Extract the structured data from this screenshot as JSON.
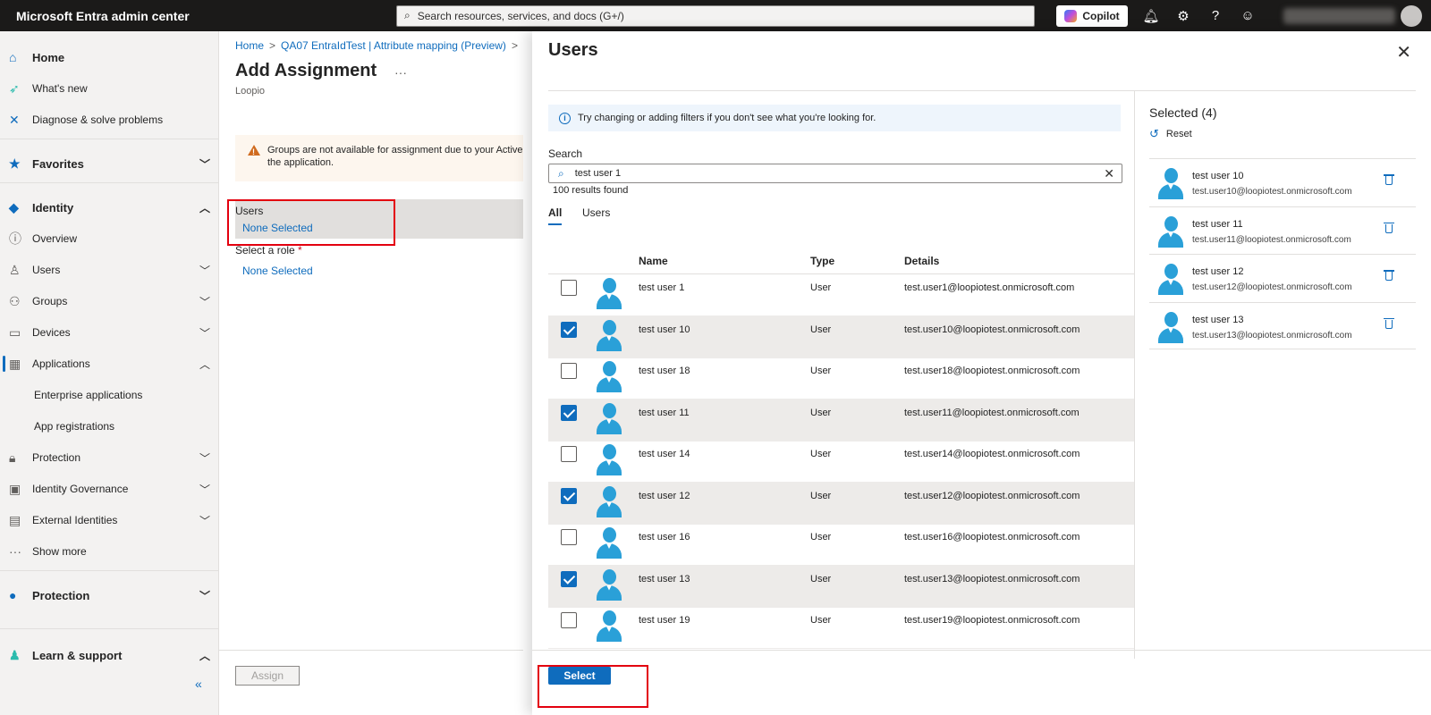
{
  "topbar": {
    "brand": "Microsoft Entra admin center",
    "search_placeholder": "Search resources, services, and docs (G+/)",
    "copilot_label": "Copilot",
    "icons": [
      "bell-icon",
      "gear-icon",
      "help-icon",
      "feedback-icon"
    ]
  },
  "nav": {
    "home": "Home",
    "whats_new": "What's new",
    "diagnose": "Diagnose & solve problems",
    "favorites": "Favorites",
    "identity": "Identity",
    "overview": "Overview",
    "users": "Users",
    "groups": "Groups",
    "devices": "Devices",
    "applications": "Applications",
    "enterprise_apps": "Enterprise applications",
    "app_registrations": "App registrations",
    "protection": "Protection",
    "identity_governance": "Identity Governance",
    "external_identities": "External Identities",
    "show_more": "Show more",
    "protection_section": "Protection",
    "learn_support": "Learn & support",
    "collapse": "«"
  },
  "main": {
    "breadcrumb": [
      "Home",
      "QA07 EntraIdTest | Attribute mapping (Preview)"
    ],
    "title": "Add Assignment",
    "subtitle": "Loopio",
    "warning_line1": "Groups are not available for assignment due to your Active Di",
    "warning_line2": "the application.",
    "users_label": "Users",
    "users_value": "None Selected",
    "role_label": "Select a role",
    "role_required": "*",
    "role_value": "None Selected",
    "assign_button": "Assign"
  },
  "panel": {
    "title": "Users",
    "info": "Try changing or adding filters if you don't see what you're looking for.",
    "search_label": "Search",
    "search_value": "test user 1",
    "results": "100 results found",
    "tabs": [
      "All",
      "Users"
    ],
    "columns": [
      "Name",
      "Type",
      "Details"
    ],
    "rows": [
      {
        "name": "test user 1",
        "type": "User",
        "details": "test.user1@loopiotest.onmicrosoft.com",
        "checked": false
      },
      {
        "name": "test user 10",
        "type": "User",
        "details": "test.user10@loopiotest.onmicrosoft.com",
        "checked": true
      },
      {
        "name": "test user 18",
        "type": "User",
        "details": "test.user18@loopiotest.onmicrosoft.com",
        "checked": false
      },
      {
        "name": "test user 11",
        "type": "User",
        "details": "test.user11@loopiotest.onmicrosoft.com",
        "checked": true
      },
      {
        "name": "test user 14",
        "type": "User",
        "details": "test.user14@loopiotest.onmicrosoft.com",
        "checked": false
      },
      {
        "name": "test user 12",
        "type": "User",
        "details": "test.user12@loopiotest.onmicrosoft.com",
        "checked": true
      },
      {
        "name": "test user 16",
        "type": "User",
        "details": "test.user16@loopiotest.onmicrosoft.com",
        "checked": false
      },
      {
        "name": "test user 13",
        "type": "User",
        "details": "test.user13@loopiotest.onmicrosoft.com",
        "checked": true
      },
      {
        "name": "test user 19",
        "type": "User",
        "details": "test.user19@loopiotest.onmicrosoft.com",
        "checked": false
      }
    ],
    "selected_title": "Selected (4)",
    "reset_label": "Reset",
    "selected": [
      {
        "name": "test user 10",
        "email": "test.user10@loopiotest.onmicrosoft.com"
      },
      {
        "name": "test user 11",
        "email": "test.user11@loopiotest.onmicrosoft.com"
      },
      {
        "name": "test user 12",
        "email": "test.user12@loopiotest.onmicrosoft.com"
      },
      {
        "name": "test user 13",
        "email": "test.user13@loopiotest.onmicrosoft.com"
      }
    ],
    "select_button": "Select"
  },
  "colors": {
    "accent": "#0f6cbd",
    "highlight": "#e3000f",
    "topbar": "#1b1a19"
  }
}
